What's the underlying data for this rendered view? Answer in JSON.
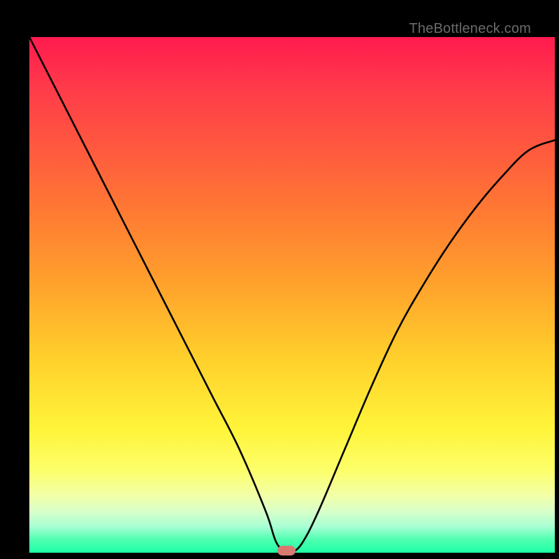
{
  "watermark": "TheBottleneck.com",
  "colors": {
    "gradient_top": "#ff1a4e",
    "gradient_bottom": "#1effa6",
    "curve": "#000000",
    "marker": "#d87a71",
    "frame": "#000000"
  },
  "chart_data": {
    "type": "line",
    "title": "",
    "xlabel": "",
    "ylabel": "",
    "xlim": [
      0,
      100
    ],
    "ylim": [
      0,
      100
    ],
    "grid": false,
    "legend": false,
    "series": [
      {
        "name": "bottleneck-curve",
        "x": [
          0,
          5,
          10,
          15,
          20,
          25,
          30,
          35,
          40,
          45,
          47,
          49,
          50,
          52,
          55,
          60,
          65,
          70,
          75,
          80,
          85,
          90,
          95,
          100
        ],
        "y": [
          100,
          90,
          80,
          70,
          60,
          50,
          40,
          30,
          20,
          8,
          2,
          0,
          0,
          2,
          8,
          20,
          32,
          43,
          52,
          60,
          67,
          73,
          78,
          80
        ]
      }
    ],
    "annotations": [
      {
        "name": "minimum-marker",
        "x": 49,
        "y": 0
      }
    ]
  }
}
